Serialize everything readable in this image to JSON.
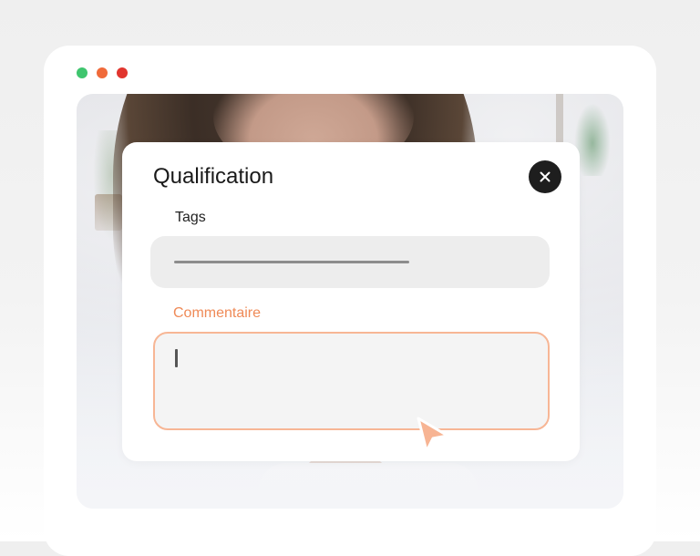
{
  "window": {
    "controls": [
      {
        "name": "zoom",
        "color": "#3fc56e"
      },
      {
        "name": "minimize",
        "color": "#f06a3a"
      },
      {
        "name": "close",
        "color": "#e1352e"
      }
    ]
  },
  "modal": {
    "title": "Qualification",
    "close_icon": "close-icon",
    "tags": {
      "label": "Tags",
      "value": ""
    },
    "comment": {
      "label": "Commentaire",
      "value": "",
      "focused": true,
      "accent_color": "#ef8a57"
    }
  },
  "cursor": {
    "icon": "mouse-pointer-icon",
    "color": "#f7b493"
  }
}
